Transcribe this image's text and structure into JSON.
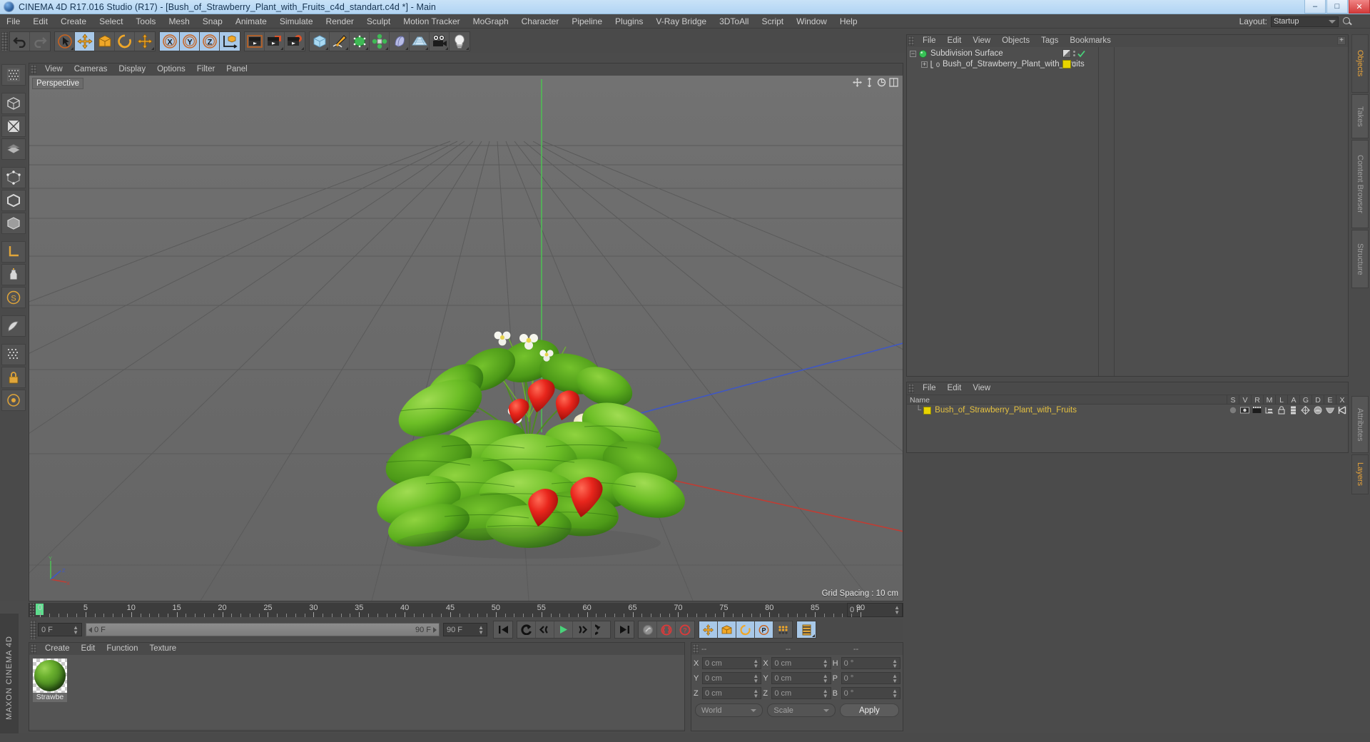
{
  "window": {
    "title": "CINEMA 4D R17.016 Studio (R17) - [Bush_of_Strawberry_Plant_with_Fruits_c4d_standart.c4d *] - Main",
    "minimize": "–",
    "maximize": "□",
    "close": "✕"
  },
  "menubar": {
    "items": [
      "File",
      "Edit",
      "Create",
      "Select",
      "Tools",
      "Mesh",
      "Snap",
      "Animate",
      "Simulate",
      "Render",
      "Sculpt",
      "Motion Tracker",
      "MoGraph",
      "Character",
      "Pipeline",
      "Plugins",
      "V-Ray Bridge",
      "3DToAll",
      "Script",
      "Window",
      "Help"
    ],
    "layout_label": "Layout:",
    "layout_value": "Startup"
  },
  "viewport": {
    "menu": [
      "View",
      "Cameras",
      "Display",
      "Options",
      "Filter",
      "Panel"
    ],
    "label": "Perspective",
    "grid_spacing": "Grid Spacing : 10 cm",
    "axis_labels": {
      "x": "X",
      "y": "Y",
      "z": "Z"
    }
  },
  "timeline": {
    "ticks": [
      0,
      5,
      10,
      15,
      20,
      25,
      30,
      35,
      40,
      45,
      50,
      55,
      60,
      65,
      70,
      75,
      80,
      85,
      90
    ],
    "min_frame": 0,
    "max_frame": 90,
    "current_frame_field": "0 F",
    "range_start": "0 F",
    "range_end": "90 F",
    "end_frame_field": "90 F",
    "preview_field": "0 F"
  },
  "material_manager": {
    "menu": [
      "Create",
      "Edit",
      "Function",
      "Texture"
    ],
    "materials": [
      {
        "name": "Strawbe",
        "color": "#6ab02e"
      }
    ]
  },
  "coordinates": {
    "headers": [
      "--",
      "--",
      "--"
    ],
    "rows": [
      {
        "pos_label": "X",
        "pos_value": "0 cm",
        "size_label": "X",
        "size_value": "0 cm",
        "rot_label": "H",
        "rot_value": "0 °"
      },
      {
        "pos_label": "Y",
        "pos_value": "0 cm",
        "size_label": "Y",
        "size_value": "0 cm",
        "rot_label": "P",
        "rot_value": "0 °"
      },
      {
        "pos_label": "Z",
        "pos_value": "0 cm",
        "size_label": "Z",
        "size_value": "0 cm",
        "rot_label": "B",
        "rot_value": "0 °"
      }
    ],
    "system": "World",
    "mode": "Scale",
    "apply": "Apply"
  },
  "object_manager": {
    "menu": [
      "File",
      "Edit",
      "View",
      "Objects",
      "Tags",
      "Bookmarks"
    ],
    "objects": [
      {
        "name": "Subdivision Surface",
        "depth": 0,
        "icon": "subdivision-surface-icon"
      },
      {
        "name": "Bush_of_Strawberry_Plant_with_Fruits",
        "depth": 1,
        "icon": "polygon-object-icon",
        "level": "0"
      }
    ]
  },
  "attribute_manager": {
    "menu": [
      "File",
      "Edit",
      "View"
    ],
    "columns": [
      "Name",
      "S",
      "V",
      "R",
      "M",
      "L",
      "A",
      "G",
      "D",
      "E",
      "X"
    ],
    "rows": [
      {
        "name": "Bush_of_Strawberry_Plant_with_Fruits",
        "color": "#e8d400"
      }
    ]
  },
  "right_tabs": [
    {
      "label": "Objects",
      "active": true
    },
    {
      "label": "Takes",
      "active": false
    },
    {
      "label": "Content Browser",
      "active": false
    },
    {
      "label": "Structure",
      "active": false
    }
  ],
  "right_tabs_lower": [
    {
      "label": "Attributes",
      "active": false
    },
    {
      "label": "Layers",
      "active": true
    }
  ],
  "branding": "MAXON CINEMA 4D",
  "colors": {
    "accent_orange": "#e7a33a",
    "highlight_blue": "#a8c8e8",
    "tag_yellow": "#e8d400",
    "playhead_green": "#5ede8e",
    "axis_x": "#c0392b",
    "axis_y": "#44b544",
    "axis_z": "#3b5fd0"
  }
}
